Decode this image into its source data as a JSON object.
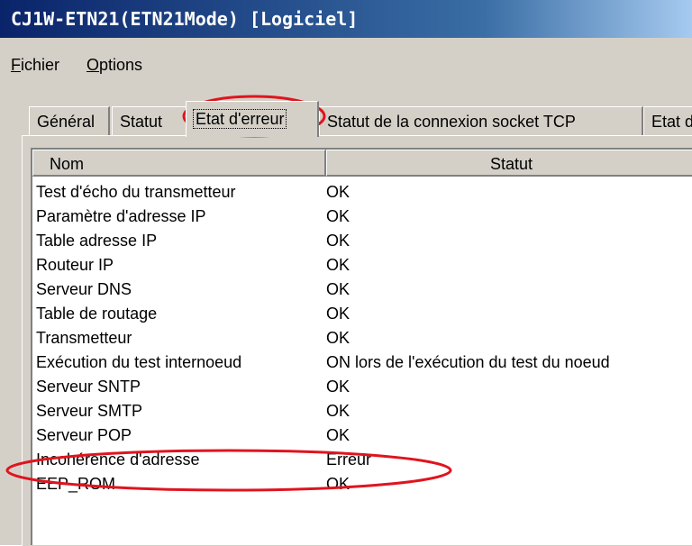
{
  "window": {
    "title": "CJ1W-ETN21(ETN21Mode) [Logiciel]"
  },
  "menu": {
    "fichier": {
      "first": "F",
      "rest": "ichier"
    },
    "options": {
      "first": "O",
      "rest": "ptions"
    }
  },
  "tabs": [
    {
      "label": "Général"
    },
    {
      "label": "Statut"
    },
    {
      "label": "Etat d'erreur"
    },
    {
      "label": "Statut de la connexion socket TCP"
    },
    {
      "label": "Etat d"
    }
  ],
  "list": {
    "columns": [
      "Nom",
      "Statut"
    ],
    "rows": [
      {
        "name": "Test d'écho du transmetteur",
        "status": "OK"
      },
      {
        "name": "Paramètre d'adresse IP",
        "status": "OK"
      },
      {
        "name": "Table adresse IP",
        "status": "OK"
      },
      {
        "name": "Routeur IP",
        "status": "OK"
      },
      {
        "name": "Serveur DNS",
        "status": "OK"
      },
      {
        "name": "Table de routage",
        "status": "OK"
      },
      {
        "name": "Transmetteur",
        "status": "OK"
      },
      {
        "name": "Exécution du test internoeud",
        "status": "ON lors de l'exécution du test du noeud"
      },
      {
        "name": "Serveur SNTP",
        "status": "OK"
      },
      {
        "name": "Serveur SMTP",
        "status": "OK"
      },
      {
        "name": "Serveur POP",
        "status": "OK"
      },
      {
        "name": "Incohérence d'adresse",
        "status": "Erreur"
      },
      {
        "name": "EEP_ROM",
        "status": "OK"
      }
    ]
  },
  "annotation_color": "#e0141e"
}
